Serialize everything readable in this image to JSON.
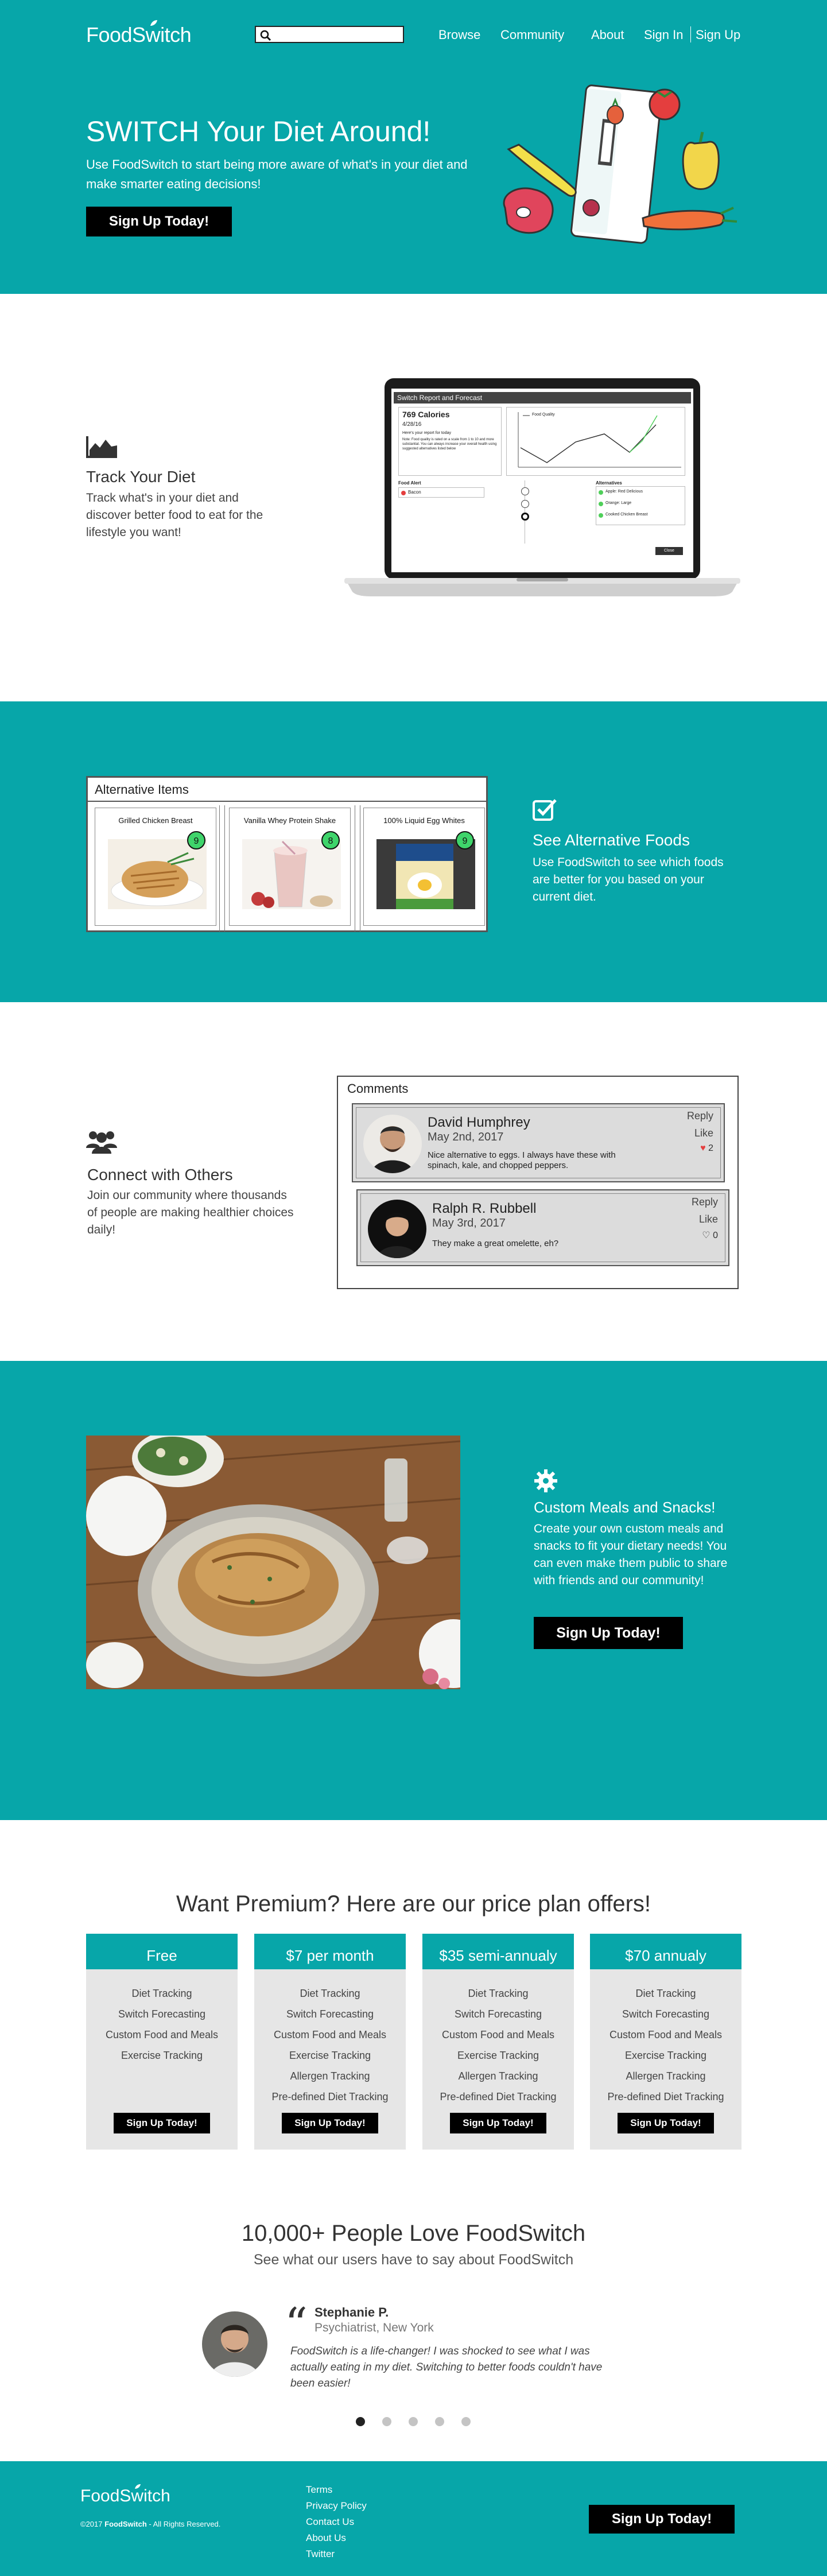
{
  "brand": {
    "name_a": "FoodS",
    "name_b": "w",
    "name_c": "itch",
    "teal": "#07a6a9"
  },
  "header": {
    "search": {
      "placeholder": "",
      "value": ""
    },
    "nav": {
      "browse": "Browse",
      "community": "Community",
      "about": "About",
      "sign_in": "Sign In",
      "sign_up": "Sign Up"
    }
  },
  "hero": {
    "title": "SWITCH Your Diet Around!",
    "subtitle": "Use FoodSwitch to start being more aware of what's in your diet and make smarter eating decisions!",
    "cta": "Sign Up Today!"
  },
  "track": {
    "title": "Track Your Diet",
    "text": "Track what's in your diet and discover better food to eat for the lifestyle you want!",
    "screen": {
      "window_title": "Switch Report and Forecast",
      "calories": "769 Calories",
      "date": "4/28/16",
      "report_label": "Here's your report for today",
      "notes": [
        "Note: Food quality is rated on a scale from 1 to 10 and more substantial. You can always increase your overall health using suggested alternatives listed below"
      ],
      "chart_legend": "Food Quality",
      "food_alert_label": "Food Alert",
      "food_alert_item": "Bacon",
      "alternatives_label": "Alternatives",
      "alternatives": [
        "Apple: Red Delicious",
        "Orange: Large",
        "Cooked Chicken Breast"
      ],
      "close_btn": "Close"
    }
  },
  "alternatives": {
    "panel_title": "Alternative Items",
    "items": [
      {
        "name": "Grilled Chicken Breast",
        "score": "9"
      },
      {
        "name": "Vanilla Whey Protein Shake",
        "score": "8"
      },
      {
        "name": "100% Liquid Egg Whites",
        "score": "9"
      }
    ],
    "title": "See Alternative Foods",
    "text": "Use FoodSwitch to see which foods are better for you based on your current diet."
  },
  "connect": {
    "title": "Connect with Others",
    "text": "Join our community where thousands of people are making healthier choices daily!",
    "comments_title": "Comments",
    "comments": [
      {
        "name": "David Humphrey",
        "date": "May 2nd, 2017",
        "text": "Nice alternative to eggs. I always have these with spinach, kale, and chopped peppers.",
        "reply": "Reply",
        "like": "Like",
        "likes": "2"
      },
      {
        "name": "Ralph R. Rubbell",
        "date": "May 3rd, 2017",
        "text": "They make a great omelette, eh?",
        "reply": "Reply",
        "like": "Like",
        "likes": "0"
      }
    ]
  },
  "meals": {
    "title": "Custom Meals and Snacks!",
    "text": "Create your own custom meals and snacks to fit your dietary needs! You can even make them public to share with friends and our community!",
    "cta": "Sign Up Today!"
  },
  "pricing": {
    "title": "Want Premium? Here are our price plan offers!",
    "plans": [
      {
        "name": "Free",
        "features": [
          "Diet Tracking",
          "Switch Forecasting",
          "Custom Food and Meals",
          "Exercise Tracking"
        ],
        "cta": "Sign Up Today!"
      },
      {
        "name": "$7 per month",
        "features": [
          "Diet Tracking",
          "Switch Forecasting",
          "Custom Food and Meals",
          "Exercise Tracking",
          "Allergen Tracking",
          "Pre-defined Diet Tracking"
        ],
        "cta": "Sign Up Today!"
      },
      {
        "name": "$35 semi-annualy",
        "features": [
          "Diet Tracking",
          "Switch Forecasting",
          "Custom Food and Meals",
          "Exercise Tracking",
          "Allergen Tracking",
          "Pre-defined Diet Tracking"
        ],
        "cta": "Sign Up Today!"
      },
      {
        "name": "$70 annualy",
        "features": [
          "Diet Tracking",
          "Switch Forecasting",
          "Custom Food and Meals",
          "Exercise Tracking",
          "Allergen Tracking",
          "Pre-defined Diet Tracking"
        ],
        "cta": "Sign Up Today!"
      }
    ]
  },
  "testimonials": {
    "title": "10,000+ People Love FoodSwitch",
    "subtitle": "See what our users have to say about FoodSwitch",
    "name": "Stephanie P.",
    "role": "Psychiatrist, New York",
    "quote": "FoodSwitch is a life-changer! I was shocked to see what I was actually eating in my diet. Switching to better foods couldn't have been easier!",
    "dots": 5,
    "active_dot": 1
  },
  "footer": {
    "copyright_pre": "©2017 ",
    "copyright_brand": "FoodSwitch",
    "copyright_post": " - All Rights Reserved.",
    "links": [
      "Terms",
      "Privacy Policy",
      "Contact Us",
      "About Us",
      "Twitter"
    ],
    "cta": "Sign Up Today!"
  }
}
